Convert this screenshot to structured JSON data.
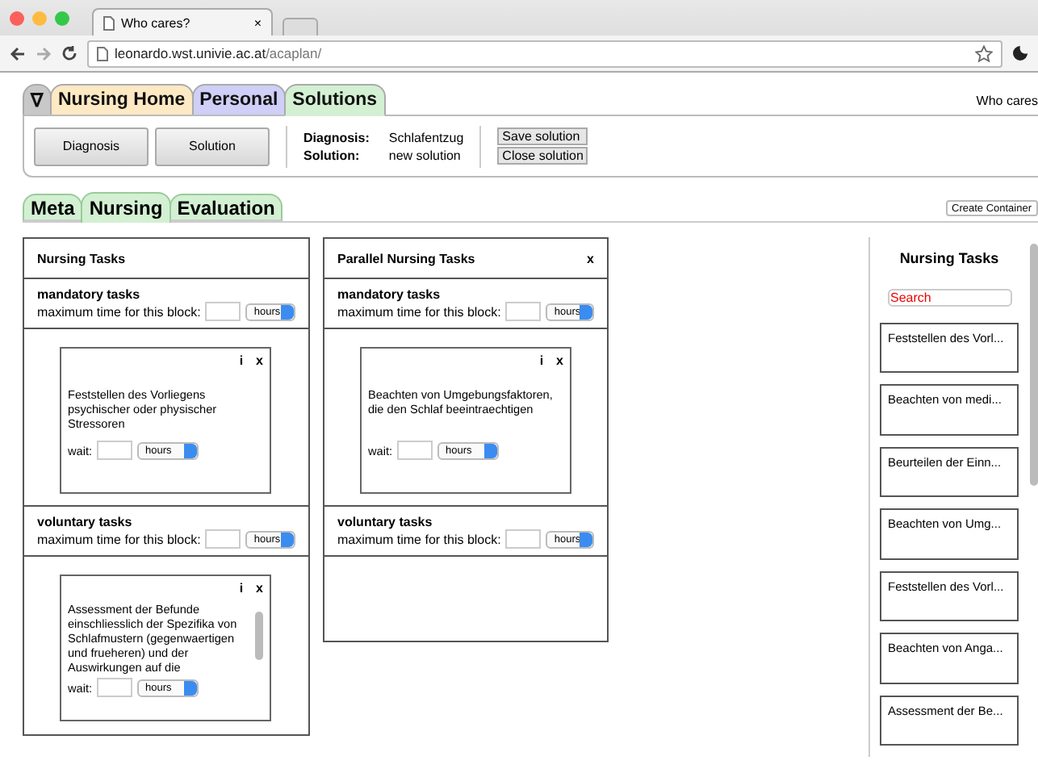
{
  "browser": {
    "tab_title": "Who cares?",
    "tab_close": "×",
    "url_host": "leonardo.wst.univie.ac.at",
    "url_path": "/acaplan/"
  },
  "top_tabs": [
    {
      "label": "∇",
      "color": "#c8c8c8",
      "selected": false
    },
    {
      "label": "Nursing Home",
      "color": "#fde9c4",
      "selected": false
    },
    {
      "label": "Personal",
      "color": "#cfcff7",
      "selected": false
    },
    {
      "label": "Solutions",
      "color": "#d3f0d3",
      "selected": true
    }
  ],
  "user": "Who cares",
  "toolbar": {
    "buttons": [
      "Diagnosis",
      "Solution"
    ],
    "info": [
      {
        "label": "Diagnosis:",
        "value": "Schlafentzug"
      },
      {
        "label": "Solution:",
        "value": "new solution"
      }
    ],
    "actions": [
      "Save solution",
      "Close solution"
    ]
  },
  "sub_tabs": [
    {
      "label": "Meta",
      "selected": false
    },
    {
      "label": "Nursing",
      "selected": true
    },
    {
      "label": "Evaluation",
      "selected": false
    }
  ],
  "create_button": "Create Container",
  "containers": [
    {
      "title": "Nursing Tasks",
      "blocks": [
        {
          "title": "mandatory tasks",
          "label": "maximum time for this block:",
          "unit": "hours",
          "tasks": [
            {
              "text": "Feststellen des Vorliegens psychischer oder physischer Stressoren",
              "info": "i",
              "close": "x",
              "wait_label": "wait:",
              "unit": "hours",
              "scrollable": false
            }
          ]
        },
        {
          "title": "voluntary tasks",
          "label": "maximum time for this block:",
          "unit": "hours",
          "tasks": [
            {
              "text": "Assessment der Befunde einschliesslich der Spezifika von Schlafmustern (gegenwaertigen und frueheren) und der Auswirkungen auf die",
              "info": "i",
              "close": "x",
              "wait_label": "wait:",
              "unit": "hours",
              "scrollable": true
            }
          ]
        }
      ]
    },
    {
      "title": "Parallel Nursing Tasks",
      "close": "x",
      "blocks": [
        {
          "title": "mandatory tasks",
          "label": "maximum time for this block:",
          "unit": "hours",
          "tasks": [
            {
              "text": "Beachten von Umgebungsfaktoren, die den Schlaf beeintraechtigen",
              "info": "i",
              "close": "x",
              "wait_label": "wait:",
              "unit": "hours",
              "scrollable": false
            }
          ]
        },
        {
          "title": "voluntary tasks",
          "label": "maximum time for this block:",
          "unit": "hours"
        }
      ]
    }
  ],
  "sidebar": {
    "title": "Nursing Tasks",
    "search": {
      "placeholder": "Search"
    },
    "items": [
      "Feststellen des Vorl...",
      "Beachten von medi...",
      "Beurteilen der Einn...",
      "Beachten von Umg...",
      "Feststellen des Vorl...",
      "Beachten von Anga...",
      "Assessment der Be..."
    ]
  }
}
